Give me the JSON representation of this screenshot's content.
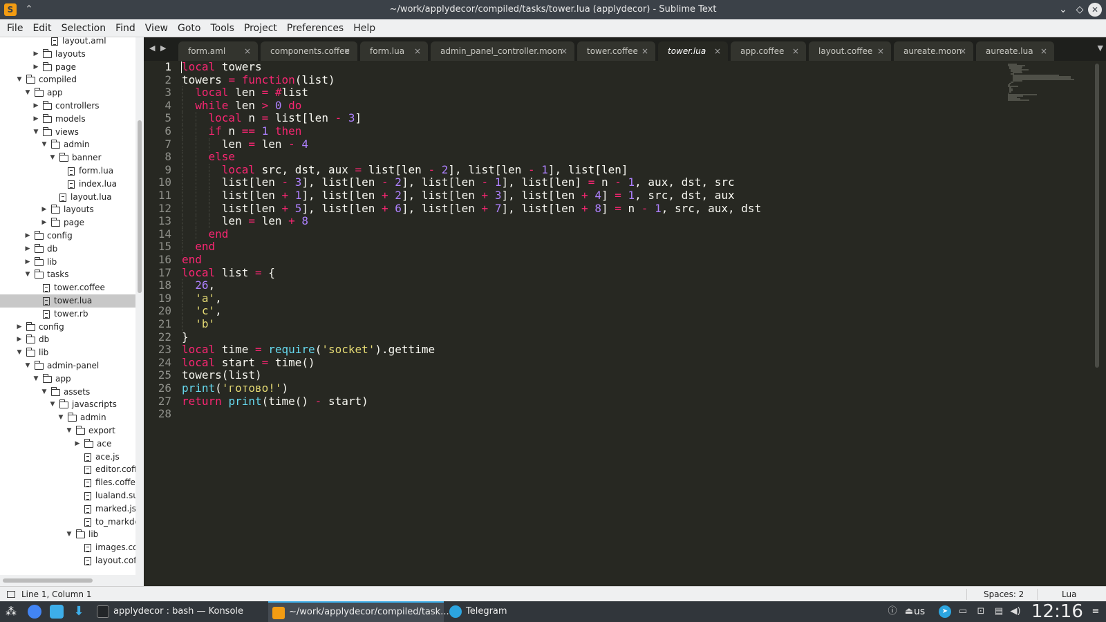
{
  "window": {
    "title": "~/work/applydecor/compiled/tasks/tower.lua (applydecor) - Sublime Text"
  },
  "menu": [
    "File",
    "Edit",
    "Selection",
    "Find",
    "View",
    "Goto",
    "Tools",
    "Project",
    "Preferences",
    "Help"
  ],
  "sidebar": {
    "rows": [
      {
        "label": "layout.aml",
        "type": "file",
        "depth": 6
      },
      {
        "label": "layouts",
        "type": "folder",
        "depth": 4,
        "open": false
      },
      {
        "label": "page",
        "type": "folder",
        "depth": 4,
        "open": false
      },
      {
        "label": "compiled",
        "type": "folder",
        "depth": 2,
        "open": true
      },
      {
        "label": "app",
        "type": "folder",
        "depth": 3,
        "open": true
      },
      {
        "label": "controllers",
        "type": "folder",
        "depth": 4,
        "open": false
      },
      {
        "label": "models",
        "type": "folder",
        "depth": 4,
        "open": false
      },
      {
        "label": "views",
        "type": "folder",
        "depth": 4,
        "open": true
      },
      {
        "label": "admin",
        "type": "folder",
        "depth": 5,
        "open": true
      },
      {
        "label": "banner",
        "type": "folder",
        "depth": 6,
        "open": true
      },
      {
        "label": "form.lua",
        "type": "file",
        "depth": 8
      },
      {
        "label": "index.lua",
        "type": "file",
        "depth": 8
      },
      {
        "label": "layout.lua",
        "type": "file",
        "depth": 7
      },
      {
        "label": "layouts",
        "type": "folder",
        "depth": 5,
        "open": false
      },
      {
        "label": "page",
        "type": "folder",
        "depth": 5,
        "open": false
      },
      {
        "label": "config",
        "type": "folder",
        "depth": 3,
        "open": false
      },
      {
        "label": "db",
        "type": "folder",
        "depth": 3,
        "open": false
      },
      {
        "label": "lib",
        "type": "folder",
        "depth": 3,
        "open": false
      },
      {
        "label": "tasks",
        "type": "folder",
        "depth": 3,
        "open": true
      },
      {
        "label": "tower.coffee",
        "type": "file",
        "depth": 5
      },
      {
        "label": "tower.lua",
        "type": "file",
        "depth": 5,
        "selected": true
      },
      {
        "label": "tower.rb",
        "type": "file",
        "depth": 5
      },
      {
        "label": "config",
        "type": "folder",
        "depth": 2,
        "open": false
      },
      {
        "label": "db",
        "type": "folder",
        "depth": 2,
        "open": false
      },
      {
        "label": "lib",
        "type": "folder",
        "depth": 2,
        "open": true
      },
      {
        "label": "admin-panel",
        "type": "folder",
        "depth": 3,
        "open": true
      },
      {
        "label": "app",
        "type": "folder",
        "depth": 4,
        "open": true
      },
      {
        "label": "assets",
        "type": "folder",
        "depth": 5,
        "open": true
      },
      {
        "label": "javascripts",
        "type": "folder",
        "depth": 6,
        "open": true
      },
      {
        "label": "admin",
        "type": "folder",
        "depth": 7,
        "open": true
      },
      {
        "label": "export",
        "type": "folder",
        "depth": 8,
        "open": true
      },
      {
        "label": "ace",
        "type": "folder",
        "depth": 9,
        "open": false
      },
      {
        "label": "ace.js",
        "type": "file",
        "depth": 10
      },
      {
        "label": "editor.coffee",
        "type": "file",
        "depth": 10
      },
      {
        "label": "files.coffee",
        "type": "file",
        "depth": 10
      },
      {
        "label": "lualand.sublime",
        "type": "file",
        "depth": 10
      },
      {
        "label": "marked.js",
        "type": "file",
        "depth": 10
      },
      {
        "label": "to_markdown.js",
        "type": "file",
        "depth": 10
      },
      {
        "label": "lib",
        "type": "folder",
        "depth": 8,
        "open": true
      },
      {
        "label": "images.coffee",
        "type": "file",
        "depth": 10
      },
      {
        "label": "layout.coffee",
        "type": "file",
        "depth": 10
      }
    ]
  },
  "tabs": [
    {
      "label": "form.aml",
      "active": false
    },
    {
      "label": "components.coffee",
      "active": false
    },
    {
      "label": "form.lua",
      "active": false
    },
    {
      "label": "admin_panel_controller.moon",
      "active": false
    },
    {
      "label": "tower.coffee",
      "active": false
    },
    {
      "label": "tower.lua",
      "active": true
    },
    {
      "label": "app.coffee",
      "active": false
    },
    {
      "label": "layout.coffee",
      "active": false
    },
    {
      "label": "aureate.moon",
      "active": false
    },
    {
      "label": "aureate.lua",
      "active": false
    }
  ],
  "tab_close_glyph": "×",
  "editor": {
    "current_line": 1,
    "lines": [
      [
        [
          "k",
          "local"
        ],
        [
          "t",
          " towers"
        ]
      ],
      [
        [
          "t",
          "towers "
        ],
        [
          "k",
          "="
        ],
        [
          "t",
          " "
        ],
        [
          "k",
          "function"
        ],
        [
          "t",
          "(list)"
        ]
      ],
      [
        [
          "t",
          "  "
        ],
        [
          "k",
          "local"
        ],
        [
          "t",
          " len "
        ],
        [
          "k",
          "="
        ],
        [
          "t",
          " "
        ],
        [
          "k",
          "#"
        ],
        [
          "t",
          "list"
        ]
      ],
      [
        [
          "t",
          "  "
        ],
        [
          "k",
          "while"
        ],
        [
          "t",
          " len "
        ],
        [
          "k",
          ">"
        ],
        [
          "t",
          " "
        ],
        [
          "n",
          "0"
        ],
        [
          "t",
          " "
        ],
        [
          "k",
          "do"
        ]
      ],
      [
        [
          "t",
          "    "
        ],
        [
          "k",
          "local"
        ],
        [
          "t",
          " n "
        ],
        [
          "k",
          "="
        ],
        [
          "t",
          " list[len "
        ],
        [
          "k",
          "-"
        ],
        [
          "t",
          " "
        ],
        [
          "n",
          "3"
        ],
        [
          "t",
          "]"
        ]
      ],
      [
        [
          "t",
          "    "
        ],
        [
          "k",
          "if"
        ],
        [
          "t",
          " n "
        ],
        [
          "k",
          "=="
        ],
        [
          "t",
          " "
        ],
        [
          "n",
          "1"
        ],
        [
          "t",
          " "
        ],
        [
          "k",
          "then"
        ]
      ],
      [
        [
          "t",
          "      len "
        ],
        [
          "k",
          "="
        ],
        [
          "t",
          " len "
        ],
        [
          "k",
          "-"
        ],
        [
          "t",
          " "
        ],
        [
          "n",
          "4"
        ]
      ],
      [
        [
          "t",
          "    "
        ],
        [
          "k",
          "else"
        ]
      ],
      [
        [
          "t",
          "      "
        ],
        [
          "k",
          "local"
        ],
        [
          "t",
          " src, dst, aux "
        ],
        [
          "k",
          "="
        ],
        [
          "t",
          " list[len "
        ],
        [
          "k",
          "-"
        ],
        [
          "t",
          " "
        ],
        [
          "n",
          "2"
        ],
        [
          "t",
          "], list[len "
        ],
        [
          "k",
          "-"
        ],
        [
          "t",
          " "
        ],
        [
          "n",
          "1"
        ],
        [
          "t",
          "], list[len]"
        ]
      ],
      [
        [
          "t",
          "      list[len "
        ],
        [
          "k",
          "-"
        ],
        [
          "t",
          " "
        ],
        [
          "n",
          "3"
        ],
        [
          "t",
          "], list[len "
        ],
        [
          "k",
          "-"
        ],
        [
          "t",
          " "
        ],
        [
          "n",
          "2"
        ],
        [
          "t",
          "], list[len "
        ],
        [
          "k",
          "-"
        ],
        [
          "t",
          " "
        ],
        [
          "n",
          "1"
        ],
        [
          "t",
          "], list[len] "
        ],
        [
          "k",
          "="
        ],
        [
          "t",
          " n "
        ],
        [
          "k",
          "-"
        ],
        [
          "t",
          " "
        ],
        [
          "n",
          "1"
        ],
        [
          "t",
          ", aux, dst, src"
        ]
      ],
      [
        [
          "t",
          "      list[len "
        ],
        [
          "k",
          "+"
        ],
        [
          "t",
          " "
        ],
        [
          "n",
          "1"
        ],
        [
          "t",
          "], list[len "
        ],
        [
          "k",
          "+"
        ],
        [
          "t",
          " "
        ],
        [
          "n",
          "2"
        ],
        [
          "t",
          "], list[len "
        ],
        [
          "k",
          "+"
        ],
        [
          "t",
          " "
        ],
        [
          "n",
          "3"
        ],
        [
          "t",
          "], list[len "
        ],
        [
          "k",
          "+"
        ],
        [
          "t",
          " "
        ],
        [
          "n",
          "4"
        ],
        [
          "t",
          "] "
        ],
        [
          "k",
          "="
        ],
        [
          "t",
          " "
        ],
        [
          "n",
          "1"
        ],
        [
          "t",
          ", src, dst, aux"
        ]
      ],
      [
        [
          "t",
          "      list[len "
        ],
        [
          "k",
          "+"
        ],
        [
          "t",
          " "
        ],
        [
          "n",
          "5"
        ],
        [
          "t",
          "], list[len "
        ],
        [
          "k",
          "+"
        ],
        [
          "t",
          " "
        ],
        [
          "n",
          "6"
        ],
        [
          "t",
          "], list[len "
        ],
        [
          "k",
          "+"
        ],
        [
          "t",
          " "
        ],
        [
          "n",
          "7"
        ],
        [
          "t",
          "], list[len "
        ],
        [
          "k",
          "+"
        ],
        [
          "t",
          " "
        ],
        [
          "n",
          "8"
        ],
        [
          "t",
          "] "
        ],
        [
          "k",
          "="
        ],
        [
          "t",
          " n "
        ],
        [
          "k",
          "-"
        ],
        [
          "t",
          " "
        ],
        [
          "n",
          "1"
        ],
        [
          "t",
          ", src, aux, dst"
        ]
      ],
      [
        [
          "t",
          "      len "
        ],
        [
          "k",
          "="
        ],
        [
          "t",
          " len "
        ],
        [
          "k",
          "+"
        ],
        [
          "t",
          " "
        ],
        [
          "n",
          "8"
        ]
      ],
      [
        [
          "t",
          "    "
        ],
        [
          "k",
          "end"
        ]
      ],
      [
        [
          "t",
          "  "
        ],
        [
          "k",
          "end"
        ]
      ],
      [
        [
          "k",
          "end"
        ]
      ],
      [
        [
          "k",
          "local"
        ],
        [
          "t",
          " list "
        ],
        [
          "k",
          "="
        ],
        [
          "t",
          " {"
        ]
      ],
      [
        [
          "t",
          "  "
        ],
        [
          "n",
          "26"
        ],
        [
          "t",
          ","
        ]
      ],
      [
        [
          "t",
          "  "
        ],
        [
          "s",
          "'a'"
        ],
        [
          "t",
          ","
        ]
      ],
      [
        [
          "t",
          "  "
        ],
        [
          "s",
          "'c'"
        ],
        [
          "t",
          ","
        ]
      ],
      [
        [
          "t",
          "  "
        ],
        [
          "s",
          "'b'"
        ]
      ],
      [
        [
          "t",
          "}"
        ]
      ],
      [
        [
          "k",
          "local"
        ],
        [
          "t",
          " time "
        ],
        [
          "k",
          "="
        ],
        [
          "t",
          " "
        ],
        [
          "b",
          "require"
        ],
        [
          "t",
          "("
        ],
        [
          "s",
          "'socket'"
        ],
        [
          "t",
          ").gettime"
        ]
      ],
      [
        [
          "k",
          "local"
        ],
        [
          "t",
          " start "
        ],
        [
          "k",
          "="
        ],
        [
          "t",
          " time()"
        ]
      ],
      [
        [
          "t",
          "towers(list)"
        ]
      ],
      [
        [
          "b",
          "print"
        ],
        [
          "t",
          "("
        ],
        [
          "s",
          "'готово!'"
        ],
        [
          "t",
          ")"
        ]
      ],
      [
        [
          "k",
          "return"
        ],
        [
          "t",
          " "
        ],
        [
          "b",
          "print"
        ],
        [
          "t",
          "(time() "
        ],
        [
          "k",
          "-"
        ],
        [
          "t",
          " start)"
        ]
      ],
      []
    ]
  },
  "statusbar": {
    "position": "Line 1, Column 1",
    "spaces": "Spaces: 2",
    "syntax": "Lua"
  },
  "taskbar": {
    "tasks": [
      {
        "label": "applydecor : bash — Konsole",
        "icon": "konsole-icon",
        "active": false
      },
      {
        "label": "~/work/applydecor/compiled/task...",
        "icon": "sublime-icon",
        "active": true
      },
      {
        "label": "Telegram",
        "icon": "telegram-icon",
        "active": false
      }
    ],
    "keyboard_layout": "us",
    "clock": "12:16"
  },
  "colors": {
    "keyword": "#f92672",
    "number": "#ae81ff",
    "string": "#e6db74",
    "builtin": "#66d9ef",
    "text": "#f8f8f2",
    "background": "#272822"
  }
}
